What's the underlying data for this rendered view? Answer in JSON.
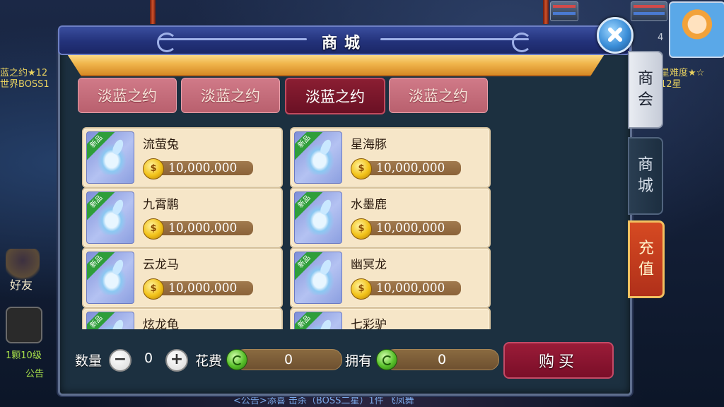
{
  "background": {
    "left_texts": [
      "蓝之约★12",
      "世界BOSS1",
      "1颗10级",
      "公告",
      "好友"
    ],
    "right_texts": [
      "星难度★☆",
      "12星"
    ],
    "avatar_badge": "4",
    "bottom_ticker": "<公告>添喜 击杀（BOSS二星）1件 飞凤舞"
  },
  "panel": {
    "title": "商城",
    "close_icon": "close-icon"
  },
  "category_tabs": [
    {
      "label": "淡蓝之约",
      "active": false
    },
    {
      "label": "淡蓝之约",
      "active": false
    },
    {
      "label": "淡蓝之约",
      "active": true
    },
    {
      "label": "淡蓝之约",
      "active": false
    }
  ],
  "items": [
    {
      "name": "流萤兔",
      "price": "10,000,000",
      "badge": "新品"
    },
    {
      "name": "星海豚",
      "price": "10,000,000",
      "badge": "新品"
    },
    {
      "name": "九霄鹏",
      "price": "10,000,000",
      "badge": "新品"
    },
    {
      "name": "水墨鹿",
      "price": "10,000,000",
      "badge": "新品"
    },
    {
      "name": "云龙马",
      "price": "10,000,000",
      "badge": "新品"
    },
    {
      "name": "幽冥龙",
      "price": "10,000,000",
      "badge": "新品"
    },
    {
      "name": "炫龙龟",
      "price": "",
      "badge": "新品"
    },
    {
      "name": "七彩驴",
      "price": "",
      "badge": "新品"
    }
  ],
  "side_tabs": [
    {
      "chars": [
        "商",
        "会"
      ]
    },
    {
      "chars": [
        "商",
        "城"
      ]
    },
    {
      "chars": [
        "充",
        "值"
      ]
    }
  ],
  "footer": {
    "qty_label": "数量",
    "qty_value": "0",
    "minus_symbol": "−",
    "plus_symbol": "+",
    "cost_label": "花费",
    "cost_value": "0",
    "own_label": "拥有",
    "own_value": "0",
    "buy_label": "购买",
    "currency_icon": "jade-coin-icon"
  },
  "colors": {
    "active_tab": "#8a1e32",
    "inactive_tab": "#c56e7c",
    "recharge": "#c83a1e",
    "new_badge": "#2f9e3a"
  }
}
